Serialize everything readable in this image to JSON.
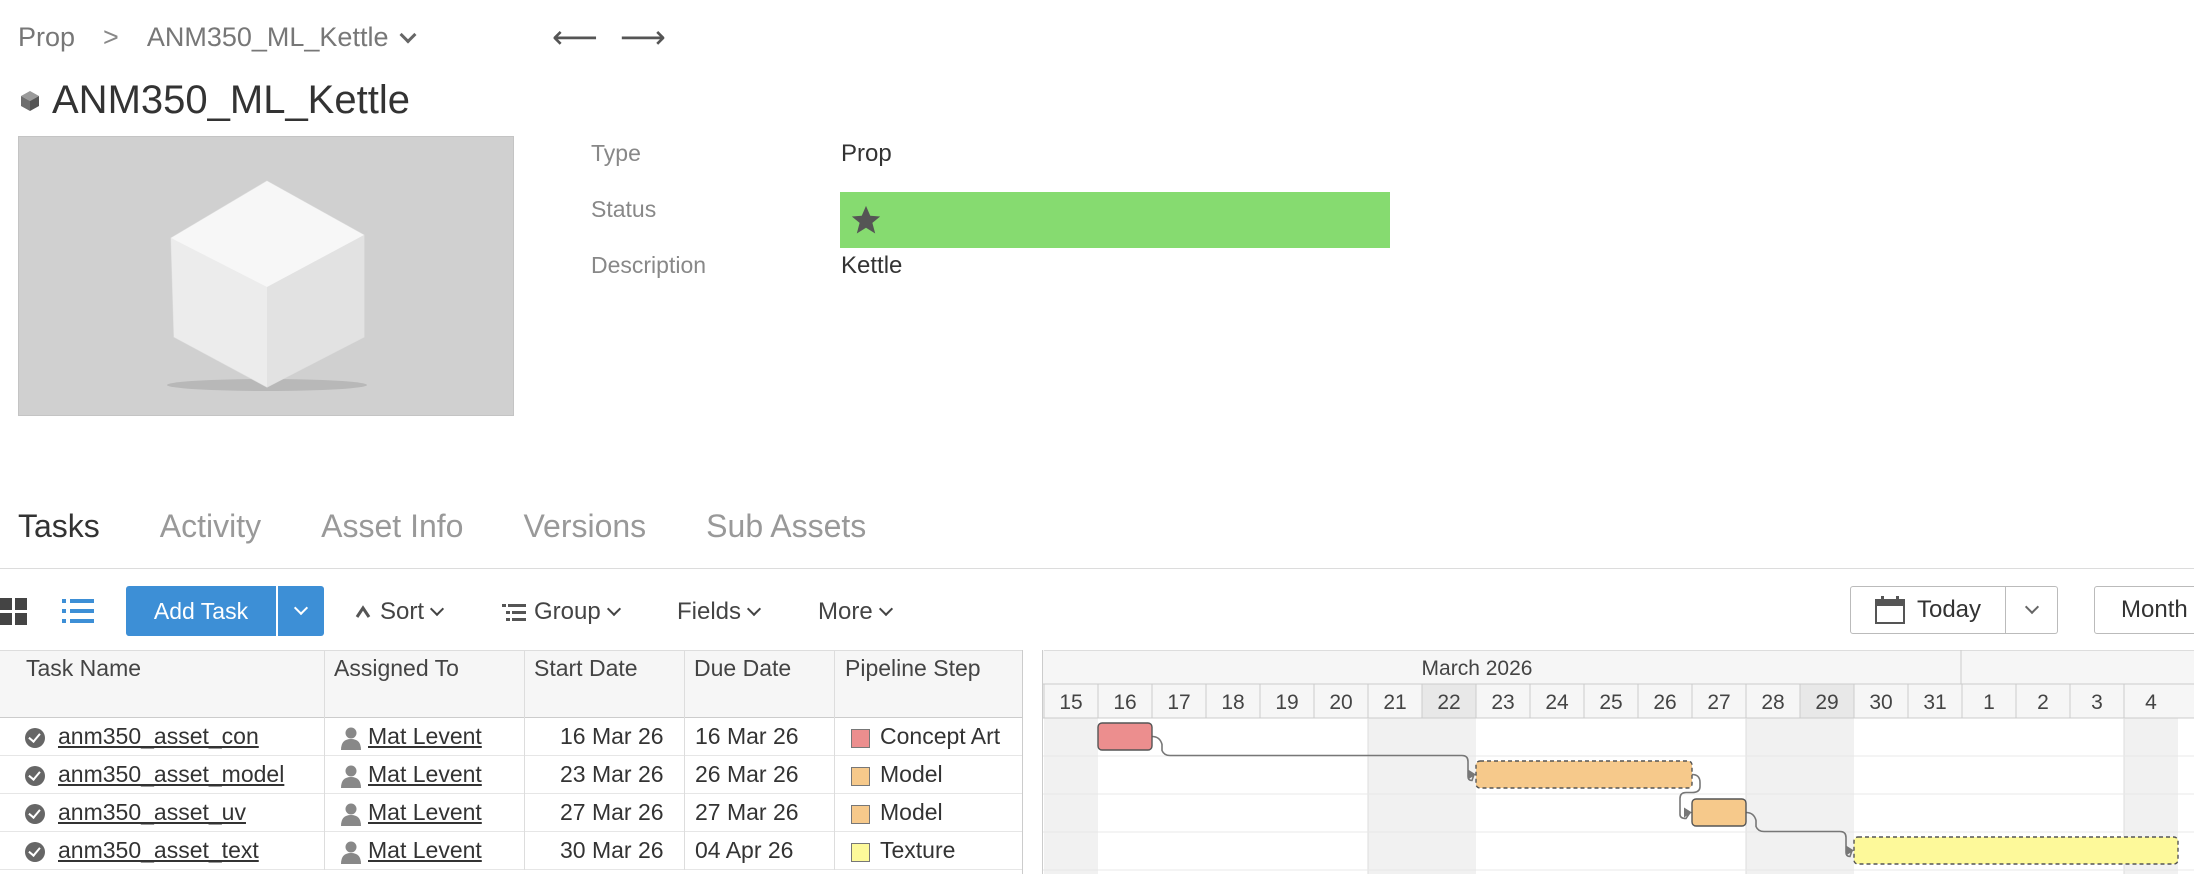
{
  "breadcrumb": {
    "root": "Prop",
    "separator": ">",
    "current": "ANM350_ML_Kettle"
  },
  "nav": {
    "back": "⟵",
    "forward": "⟶"
  },
  "asset": {
    "title": "ANM350_ML_Kettle",
    "fields": {
      "type_label": "Type",
      "type_value": "Prop",
      "status_label": "Status",
      "status_color": "#86db70",
      "description_label": "Description",
      "description_value": "Kettle"
    }
  },
  "tabs": [
    "Tasks",
    "Activity",
    "Asset Info",
    "Versions",
    "Sub Assets"
  ],
  "toolbar": {
    "add_task": "Add Task",
    "sort": "Sort",
    "group": "Group",
    "fields": "Fields",
    "more": "More",
    "today": "Today",
    "month": "Month"
  },
  "table": {
    "columns": [
      "Task Name",
      "Assigned To",
      "Start Date",
      "Due Date",
      "Pipeline Step"
    ],
    "rows": [
      {
        "task": "anm350_asset_con",
        "assignee": "Mat Levent",
        "start": "16 Mar 26",
        "due": "16 Mar 26",
        "step": "Concept Art",
        "step_color": "#ec8e8e"
      },
      {
        "task": "anm350_asset_model",
        "assignee": "Mat Levent",
        "start": "23 Mar 26",
        "due": "26 Mar 26",
        "step": "Model",
        "step_color": "#f6c98b"
      },
      {
        "task": "anm350_asset_uv",
        "assignee": "Mat Levent",
        "start": "27 Mar 26",
        "due": "27 Mar 26",
        "step": "Model",
        "step_color": "#f6c98b"
      },
      {
        "task": "anm350_asset_text",
        "assignee": "Mat Levent",
        "start": "30 Mar 26",
        "due": "04 Apr 26",
        "step": "Texture",
        "step_color": "#fdf99a"
      }
    ]
  },
  "gantt": {
    "month": "March 2026",
    "days": [
      "15",
      "16",
      "17",
      "18",
      "19",
      "20",
      "21",
      "22",
      "23",
      "24",
      "25",
      "26",
      "27",
      "28",
      "29",
      "30",
      "31",
      "1",
      "2",
      "3",
      "4"
    ]
  }
}
